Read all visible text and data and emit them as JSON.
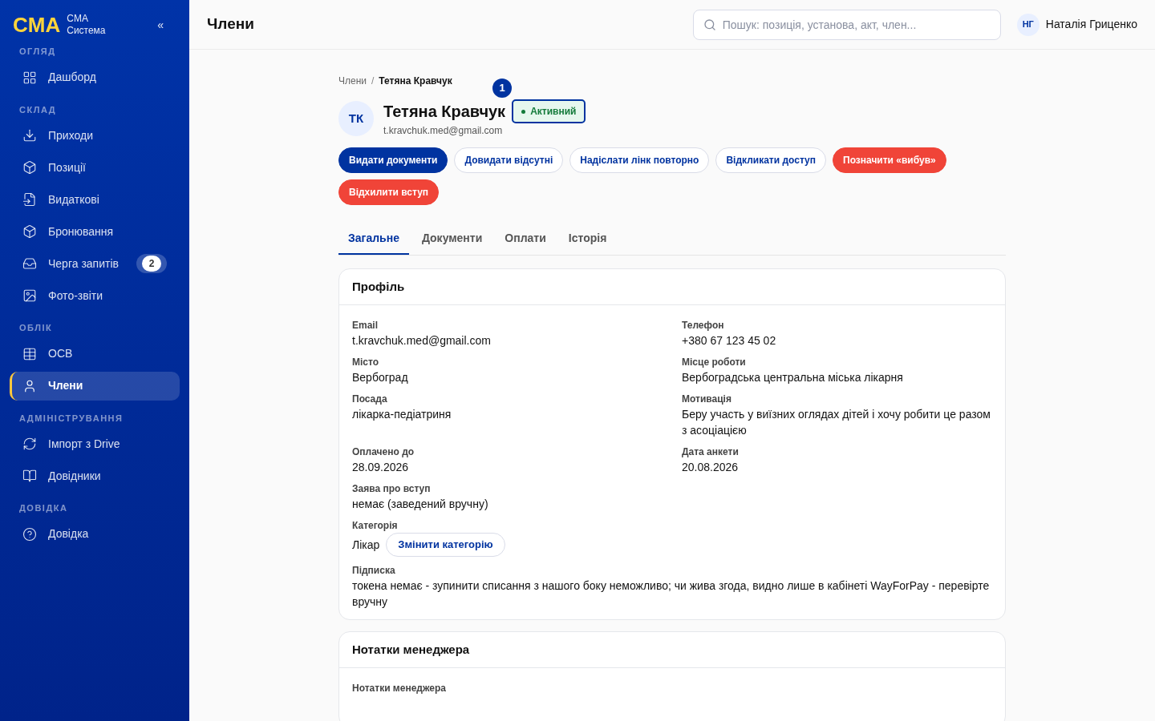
{
  "brand": {
    "logo": "CMA",
    "name_line1": "CMA",
    "name_line2": "Система",
    "collapse": "«"
  },
  "nav_sections": [
    {
      "title": "ОГЛЯД",
      "items": [
        {
          "label": "Дашборд",
          "selected": false
        }
      ]
    },
    {
      "title": "СКЛАД",
      "items": [
        {
          "label": "Приходи",
          "selected": false
        },
        {
          "label": "Позиції",
          "selected": false
        },
        {
          "label": "Видаткові",
          "selected": false
        },
        {
          "label": "Бронювання",
          "selected": false
        },
        {
          "label": "Черга запитів",
          "selected": false,
          "badge": "2"
        },
        {
          "label": "Фото-звіти",
          "selected": false
        }
      ]
    },
    {
      "title": "ОБЛІК",
      "items": [
        {
          "label": "ОСВ",
          "selected": false
        },
        {
          "label": "Члени",
          "selected": true
        }
      ]
    },
    {
      "title": "АДМІНІСТРУВАННЯ",
      "items": [
        {
          "label": "Імпорт з Drive",
          "selected": false
        },
        {
          "label": "Довідники",
          "selected": false
        }
      ]
    },
    {
      "title": "ДОВІДКА",
      "items": [
        {
          "label": "Довідка",
          "selected": false
        }
      ]
    }
  ],
  "header": {
    "title": "Члени",
    "search": {
      "placeholder": "Пошук: позиція, установа, акт, член..."
    },
    "user": {
      "initials": "НГ",
      "name": "Наталія Гриценко"
    }
  },
  "breadcrumb": {
    "items": [
      "Члени",
      "Тетяна Кравчук"
    ],
    "separator": "/"
  },
  "member": {
    "initials": "ТК",
    "name": "Тетяна Кравчук",
    "email": "t.kravchuk.med@gmail.com",
    "status": "Активний",
    "marker": "1"
  },
  "actions": [
    {
      "label": "Видати документи",
      "kind": "primary"
    },
    {
      "label": "Довидати відсутні",
      "kind": "outline"
    },
    {
      "label": "Надіслати лінк повторно",
      "kind": "outline"
    },
    {
      "label": "Відкликати доступ",
      "kind": "outline"
    },
    {
      "label": "Позначити «вибув»",
      "kind": "danger"
    },
    {
      "label": "Відхилити вступ",
      "kind": "danger"
    }
  ],
  "tabs": [
    {
      "label": "Загальне",
      "selected": true
    },
    {
      "label": "Документи",
      "selected": false
    },
    {
      "label": "Оплати",
      "selected": false
    },
    {
      "label": "Історія",
      "selected": false
    }
  ],
  "profile": {
    "title": "Профіль",
    "rows": [
      [
        {
          "label": "Email",
          "value": "t.kravchuk.med@gmail.com"
        },
        {
          "label": "Телефон",
          "value": "+380 67 123 45 02"
        }
      ],
      [
        {
          "label": "Місто",
          "value": "Вербоград"
        },
        {
          "label": "Місце роботи",
          "value": "Вербоградська центральна міська лікарня"
        }
      ],
      [
        {
          "label": "Посада",
          "value": "лікарка-педіатриня"
        },
        {
          "label": "Мотивація",
          "value": "Беру участь у виїзних оглядах дітей і хочу робити це разом з асоціацією"
        }
      ],
      [
        {
          "label": "Оплачено до",
          "value": "28.09.2026"
        },
        {
          "label": "Дата анкети",
          "value": "20.08.2026"
        }
      ],
      [
        {
          "label": "Заява про вступ",
          "value": "немає (заведений вручну)"
        }
      ],
      [
        {
          "label": "Категорія",
          "value": "Лікар",
          "action": "Змінити категорію"
        }
      ],
      [
        {
          "label": "Підписка",
          "value": "токена немає - зупинити списання з нашого боку неможливо; чи жива згода, видно лише в кабінеті WayForPay - перевірте вручну"
        }
      ]
    ]
  },
  "notes": {
    "title": "Нотатки менеджера",
    "field_label": "Нотатки менеджера"
  }
}
